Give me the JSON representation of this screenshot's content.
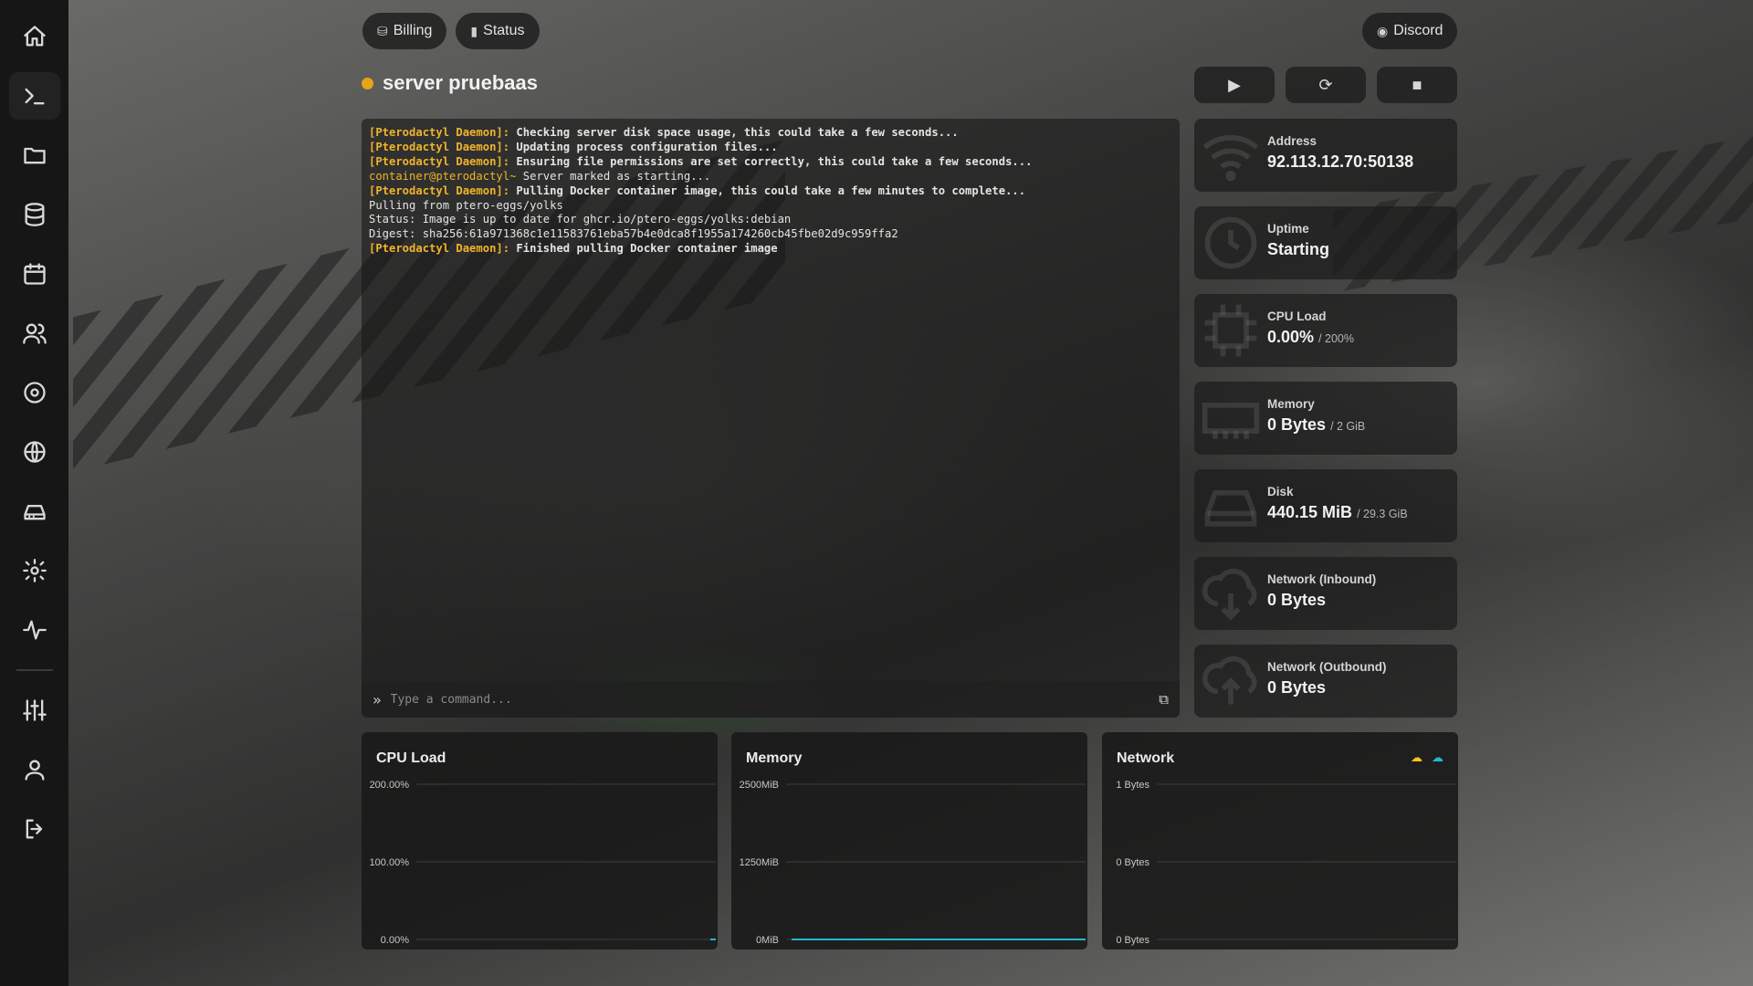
{
  "nav": {
    "billing": "Billing",
    "status": "Status",
    "discord": "Discord"
  },
  "server": {
    "name": "server pruebaas",
    "status_color": "#e8a317"
  },
  "sidebar": {
    "items": [
      "home-icon",
      "terminal-icon",
      "folder-icon",
      "database-icon",
      "calendar-icon",
      "users-icon",
      "disc-icon",
      "globe-icon",
      "drive-icon",
      "gear-icon",
      "activity-icon",
      "sliders-icon",
      "user-icon",
      "logout-icon"
    ],
    "active": "terminal-icon"
  },
  "console": {
    "lines": [
      {
        "prefix": "[Pterodactyl Daemon]:",
        "text": " Checking server disk space usage, this could take a few seconds...",
        "kind": "daemon"
      },
      {
        "prefix": "[Pterodactyl Daemon]:",
        "text": " Updating process configuration files...",
        "kind": "daemon"
      },
      {
        "prefix": "[Pterodactyl Daemon]:",
        "text": " Ensuring file permissions are set correctly, this could take a few seconds...",
        "kind": "daemon"
      },
      {
        "prefix": "container@pterodactyl~",
        "text": " Server marked as starting...",
        "kind": "container"
      },
      {
        "prefix": "[Pterodactyl Daemon]:",
        "text": " Pulling Docker container image, this could take a few minutes to complete...",
        "kind": "daemon"
      },
      {
        "prefix": "",
        "text": "Pulling from ptero-eggs/yolks",
        "kind": "plain"
      },
      {
        "prefix": "",
        "text": "Status: Image is up to date for ghcr.io/ptero-eggs/yolks:debian",
        "kind": "plain"
      },
      {
        "prefix": "",
        "text": "Digest: sha256:61a971368c1e11583761eba57b4e0dca8f1955a174260cb45fbe02d9c959ffa2",
        "kind": "plain"
      },
      {
        "prefix": "[Pterodactyl Daemon]:",
        "text": " Finished pulling Docker container image",
        "kind": "daemon"
      }
    ],
    "command_placeholder": "Type a command..."
  },
  "stats": {
    "address": {
      "label": "Address",
      "value": "92.113.12.70:50138"
    },
    "uptime": {
      "label": "Uptime",
      "value": "Starting"
    },
    "cpu": {
      "label": "CPU Load",
      "value": "0.00%",
      "limit": "/ 200%"
    },
    "memory": {
      "label": "Memory",
      "value": "0 Bytes",
      "limit": "/ 2 GiB"
    },
    "disk": {
      "label": "Disk",
      "value": "440.15 MiB",
      "limit": "/ 29.3 GiB"
    },
    "net_in": {
      "label": "Network (Inbound)",
      "value": "0 Bytes"
    },
    "net_out": {
      "label": "Network (Outbound)",
      "value": "0 Bytes"
    }
  },
  "graphs": {
    "cpu": {
      "title": "CPU Load",
      "ticks": [
        "200.00%",
        "100.00%",
        "0.00%"
      ],
      "line_color": "#22b8cf"
    },
    "memory": {
      "title": "Memory",
      "ticks": [
        "2500MiB",
        "1250MiB",
        "0MiB"
      ],
      "line_color": "#22b8cf"
    },
    "network": {
      "title": "Network",
      "ticks": [
        "1 Bytes",
        "0 Bytes",
        "0 Bytes"
      ],
      "inbound_color": "#f5c518",
      "outbound_color": "#22b8cf"
    }
  }
}
